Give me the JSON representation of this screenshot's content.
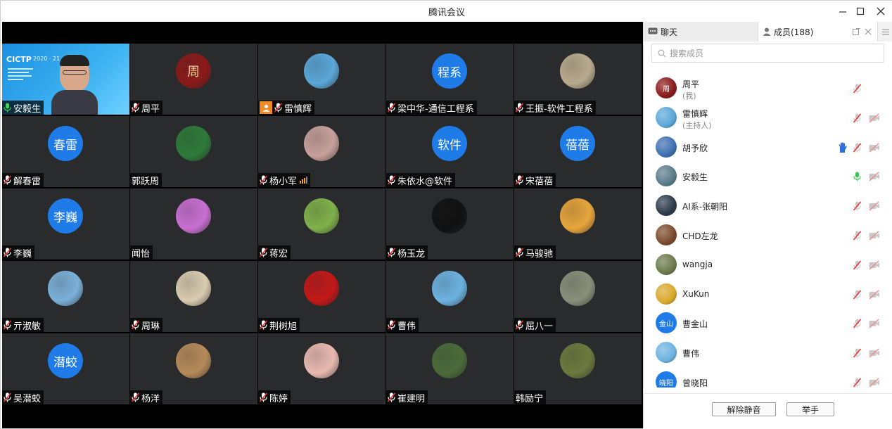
{
  "window": {
    "title": "腾讯会议"
  },
  "tiles": [
    {
      "name": "安毅生",
      "kind": "video"
    },
    {
      "name": "周平",
      "kind": "img",
      "avatar": "周",
      "color": "#8a1a1a"
    },
    {
      "name": "雷慎辉",
      "kind": "img",
      "color": "#5aa7d8",
      "host": true
    },
    {
      "name": "梁中华-通信工程系",
      "kind": "text",
      "avatar": "程系"
    },
    {
      "name": "王振-软件工程系",
      "kind": "img",
      "color": "#b9ab8d"
    },
    {
      "name": "解春雷",
      "kind": "text",
      "avatar": "春雷"
    },
    {
      "name": "郭跃周",
      "kind": "img",
      "color": "#2f7a3a",
      "nomic": true
    },
    {
      "name": "杨小军",
      "kind": "img",
      "color": "#c7a09a",
      "signal": true
    },
    {
      "name": "朱依水@软件",
      "kind": "text",
      "avatar": "软件"
    },
    {
      "name": "宋蓓蓓",
      "kind": "text",
      "avatar": "蓓蓓"
    },
    {
      "name": "李巍",
      "kind": "text",
      "avatar": "李巍"
    },
    {
      "name": "闻怡",
      "kind": "img",
      "color": "#c86fd1",
      "nomic": true
    },
    {
      "name": "蒋宏",
      "kind": "img",
      "color": "#7fb04a"
    },
    {
      "name": "杨玉龙",
      "kind": "img",
      "color": "#111111"
    },
    {
      "name": "马骏驰",
      "kind": "img",
      "color": "#e7a53c"
    },
    {
      "name": "亓淑敏",
      "kind": "img",
      "color": "#7bb0d8"
    },
    {
      "name": "周琳",
      "kind": "img",
      "color": "#d9cbb0"
    },
    {
      "name": "荆树旭",
      "kind": "img",
      "color": "#c21818"
    },
    {
      "name": "曹伟",
      "kind": "img",
      "color": "#6cb2e0"
    },
    {
      "name": "屈八一",
      "kind": "img",
      "color": "#8a8f7a"
    },
    {
      "name": "吴潜蛟",
      "kind": "text",
      "avatar": "潜蛟"
    },
    {
      "name": "杨洋",
      "kind": "img",
      "color": "#b58a5a"
    },
    {
      "name": "陈婷",
      "kind": "img",
      "color": "#e8b9b0"
    },
    {
      "name": "崔建明",
      "kind": "img",
      "color": "#4b6b3a"
    },
    {
      "name": "韩励宁",
      "kind": "img",
      "color": "#6b7a3e",
      "nomic": true
    }
  ],
  "slide": {
    "brand": "CICTP",
    "year": "2020 · 21"
  },
  "panel": {
    "tab_chat": "聊天",
    "tab_members": "成员(188)",
    "search_placeholder": "搜索成员",
    "members": [
      {
        "name": "周平",
        "sub": "(我)",
        "color": "#8a1a1a",
        "avatar": "周",
        "hand": false,
        "mic": "muted",
        "cam": false
      },
      {
        "name": "雷慎辉",
        "sub": "(主持人)",
        "color": "#5aa7d8",
        "avatar": "",
        "hand": false,
        "mic": "muted",
        "cam": true
      },
      {
        "name": "胡予欣",
        "sub": "",
        "color": "#3c6fb0",
        "avatar": "",
        "hand": true,
        "mic": "muted",
        "cam": true
      },
      {
        "name": "安毅生",
        "sub": "",
        "color": "#5a7a8a",
        "avatar": "",
        "hand": false,
        "mic": "on",
        "cam": true
      },
      {
        "name": "AI系-张朝阳",
        "sub": "",
        "color": "#2a3a4a",
        "avatar": "",
        "hand": false,
        "mic": "muted",
        "cam": true
      },
      {
        "name": "CHD左龙",
        "sub": "",
        "color": "#7a4a2a",
        "avatar": "",
        "hand": false,
        "mic": "muted",
        "cam": true
      },
      {
        "name": "wangja",
        "sub": "",
        "color": "#6a7a4a",
        "avatar": "",
        "hand": false,
        "mic": "muted",
        "cam": true
      },
      {
        "name": "XuKun",
        "sub": "",
        "color": "#d8a82a",
        "avatar": "",
        "hand": false,
        "mic": "muted",
        "cam": true
      },
      {
        "name": "曹金山",
        "sub": "",
        "color": "#1e7be8",
        "avatar": "金山",
        "hand": false,
        "mic": "muted",
        "cam": true
      },
      {
        "name": "曹伟",
        "sub": "",
        "color": "#6cb2e0",
        "avatar": "",
        "hand": false,
        "mic": "muted",
        "cam": true
      },
      {
        "name": "曾晓阳",
        "sub": "",
        "color": "#1e7be8",
        "avatar": "晓阳",
        "hand": false,
        "mic": "muted",
        "cam": true
      }
    ],
    "btn_unmute_all": "解除静音",
    "btn_raise_hand": "举手"
  }
}
